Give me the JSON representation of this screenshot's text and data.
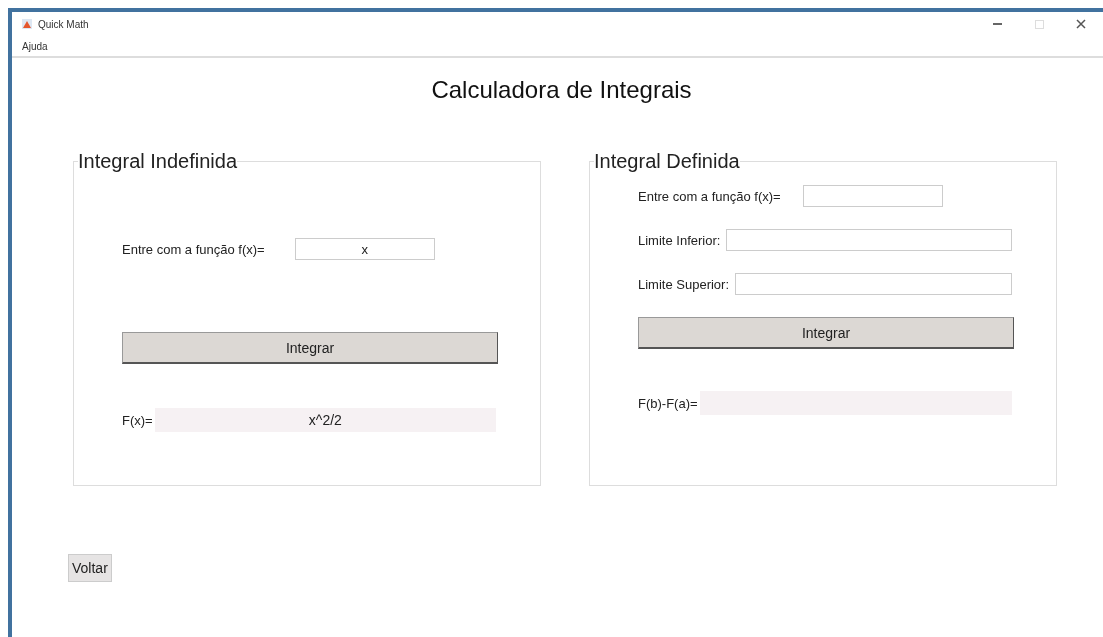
{
  "window": {
    "title": "Quick Math"
  },
  "menu": [
    "Ajuda"
  ],
  "heading": "Calculadora de Integrais",
  "panels": [
    {
      "kind": "indefinite",
      "title": "Integral Indefinida",
      "fields": [
        {
          "label": "Entre com a função f(x)=",
          "value": "x"
        }
      ],
      "button": "Integrar",
      "result_label": "F(x)=",
      "result": "x^2/2"
    },
    {
      "kind": "definite",
      "title": "Integral Definida",
      "fields": [
        {
          "label": "Entre com a função f(x)="
        },
        {
          "label": "Limite Inferior:"
        },
        {
          "label": "Limite Superior:"
        }
      ],
      "button": "Integrar",
      "result_label": "F(b)-F(a)="
    }
  ],
  "back_button": "Voltar"
}
